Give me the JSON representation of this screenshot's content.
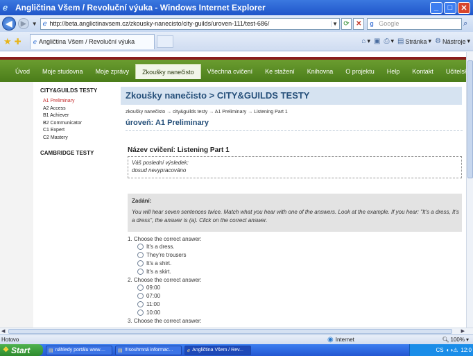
{
  "window": {
    "title": "Angličtina Všem / Revoluční výuka - Windows Internet Explorer",
    "buttons": {
      "minimize": "_",
      "maximize": "□",
      "close": "✕"
    }
  },
  "address_bar": {
    "url": "http://beta.anglictinavsem.cz/zkousky-nanecisto/city-guilds/uroven-111/test-686/",
    "search_placeholder": "Google"
  },
  "tabs": [
    {
      "label": "Angličtina Všem / Revoluční výuka"
    }
  ],
  "command_bar": {
    "page_label": "Stránka",
    "tools_label": "Nástroje"
  },
  "site_nav": {
    "items": [
      {
        "label": "Úvod"
      },
      {
        "label": "Moje studovna"
      },
      {
        "label": "Moje zprávy"
      },
      {
        "label": "Zkoušky nanečisto",
        "active": true
      },
      {
        "label": "Všechna cvičení"
      },
      {
        "label": "Ke stažení"
      },
      {
        "label": "Knihovna"
      },
      {
        "label": "O projektu"
      },
      {
        "label": "Help"
      },
      {
        "label": "Kontakt"
      },
      {
        "label": "Učitelská sekce"
      }
    ]
  },
  "sidebar": {
    "section1": "CITY&GUILDS TESTY",
    "items": [
      {
        "label": "A1 Preliminary",
        "active": true
      },
      {
        "label": "A2 Access"
      },
      {
        "label": "B1 Achiever"
      },
      {
        "label": "B2 Communicator"
      },
      {
        "label": "C1 Expert"
      },
      {
        "label": "C2 Mastery"
      }
    ],
    "section2": "CAMBRIDGE TESTY"
  },
  "main": {
    "heading": "Zkoušky nanečisto > CITY&GUILDS TESTY",
    "breadcrumb": "zkoušky nanečisto → city&guilds testy → A1 Preliminary → Listening Part 1",
    "level": "úroveň: A1 Preliminary",
    "exercise_title": "Název cvičení: Listening Part 1",
    "result_label": "Váš poslední výsledek:",
    "result_value": "dosud nevypracováno",
    "task_title": "Zadání:",
    "task_text": "You will hear seven sentences twice. Match what you hear with one of the answers. Look at the example. If you hear: \"It's a dress, It's a dress\", the answer is (a). Click on the correct answer.",
    "questions": [
      {
        "label": "1. Choose the correct answer:",
        "options": [
          "It's a dress.",
          "They're trousers",
          "It's a shirt.",
          "It's a skirt."
        ]
      },
      {
        "label": "2. Choose the correct answer:",
        "options": [
          "09:00",
          "07:00",
          "11:00",
          "10:00"
        ]
      },
      {
        "label": "3. Choose the correct answer:",
        "options": []
      }
    ]
  },
  "status_bar": {
    "status": "Hotovo",
    "zone": "Internet",
    "zoom": "100%"
  },
  "taskbar": {
    "start": "Start",
    "buttons": [
      {
        "label": "náhledy portálu www...."
      },
      {
        "label": "!!!souhrnná informac..."
      },
      {
        "label": "Angličtina Všem / Rev...",
        "active": true
      }
    ],
    "language": "CS",
    "clock": "12:0"
  },
  "colors": {
    "site_green": "#5a8c24",
    "heading_blue": "#26507a",
    "active_red": "#c32b2b"
  }
}
